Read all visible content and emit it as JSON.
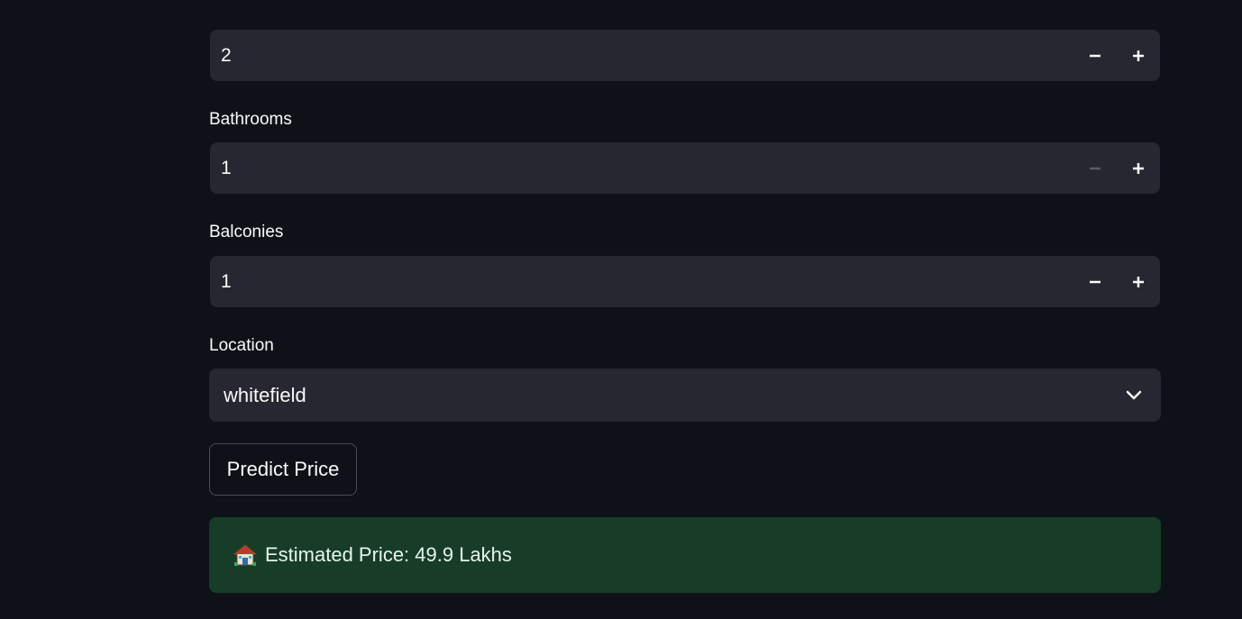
{
  "inputs": {
    "bedrooms": {
      "value": "2",
      "minus_enabled": true
    },
    "bathrooms": {
      "label": "Bathrooms",
      "value": "1",
      "minus_enabled": false
    },
    "balconies": {
      "label": "Balconies",
      "value": "1",
      "minus_enabled": true
    }
  },
  "location": {
    "label": "Location",
    "selected": "whitefield"
  },
  "predict_button": {
    "label": "Predict Price"
  },
  "result": {
    "icon": "house-icon",
    "text": "Estimated Price: 49.9 Lakhs"
  },
  "colors": {
    "background": "#0e1117",
    "input_bg": "#262730",
    "success_bg": "#173d28",
    "text": "#fafafa"
  }
}
